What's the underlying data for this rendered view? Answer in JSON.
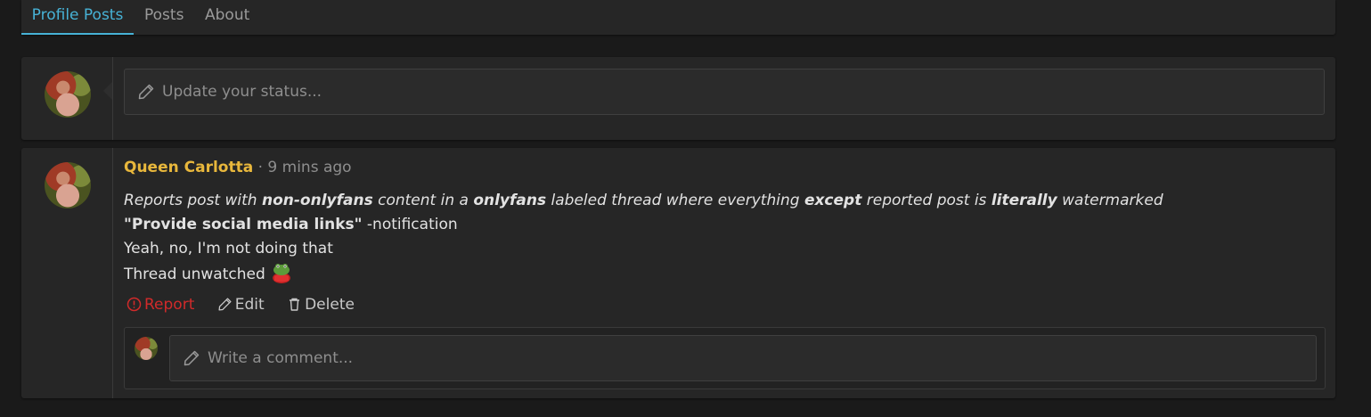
{
  "tabs": [
    {
      "label": "Profile Posts",
      "active": true
    },
    {
      "label": "Posts",
      "active": false
    },
    {
      "label": "About",
      "active": false
    }
  ],
  "status": {
    "placeholder": "Update your status..."
  },
  "post": {
    "author": "Queen Carlotta",
    "separator": "·",
    "time": "9 mins ago",
    "line1": {
      "t1": "Reports post with ",
      "b1": "non-onlyfans",
      "t2": " content in a ",
      "b2": "onlyfans",
      "t3": " labeled thread where everything ",
      "b3": "except",
      "t4": " reported post is ",
      "b4": "literally",
      "t5": " watermarked"
    },
    "line2": {
      "bold": "\"Provide social media links\"",
      "rest": " -notification"
    },
    "line3": "Yeah, no, I'm not doing that",
    "line4": "Thread unwatched",
    "emoji": "frog-emoji"
  },
  "actions": {
    "report": "Report",
    "edit": "Edit",
    "delete": "Delete"
  },
  "comment": {
    "placeholder": "Write a comment..."
  },
  "colors": {
    "background": "#1a1a1a",
    "panel": "#262626",
    "accent": "#47b2d6",
    "username": "#e8b73c",
    "report": "#d12a2a"
  }
}
